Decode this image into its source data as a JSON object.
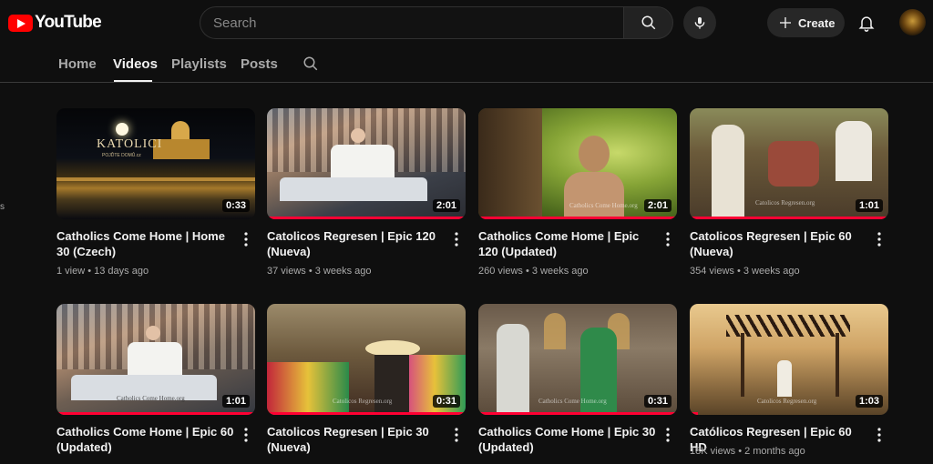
{
  "brand": {
    "name": "YouTube"
  },
  "search": {
    "placeholder": "Search"
  },
  "header": {
    "create_label": "Create"
  },
  "tabs": [
    {
      "label": "Home",
      "active": false
    },
    {
      "label": "Videos",
      "active": true
    },
    {
      "label": "Playlists",
      "active": false
    },
    {
      "label": "Posts",
      "active": false
    }
  ],
  "colors": {
    "brand_red": "#ff0000",
    "progress": "#ff0033",
    "background": "#0f0f0f"
  },
  "icons": [
    "search-icon",
    "mic-icon",
    "plus-icon",
    "bell-icon",
    "more-vert-icon"
  ],
  "videos": [
    {
      "title": "Catholics Come Home | Home 30 (Czech)",
      "meta": "1 view • 13 days ago",
      "duration": "0:33",
      "overlay": "KATOLICI",
      "overlay_sub": "POJĎTE DOMŮ.cz",
      "watched": 0
    },
    {
      "title": "Catolicos Regresen | Epic 120 (Nueva)",
      "meta": "37 views • 3 weeks ago",
      "duration": "2:01",
      "watched": 1.0
    },
    {
      "title": "Catholics Come Home | Epic 120 (Updated)",
      "meta": "260 views • 3 weeks ago",
      "duration": "2:01",
      "watermark": "Catholics Come Home.org",
      "watched": 1.0
    },
    {
      "title": "Catolicos Regresen | Epic 60 (Nueva)",
      "meta": "354 views • 3 weeks ago",
      "duration": "1:01",
      "watermark": "Catolicos Regresen.org",
      "watched": 1.0
    },
    {
      "title": "Catholics Come Home | Epic 60 (Updated)",
      "meta": "",
      "duration": "1:01",
      "watermark": "Catholics Come Home.org",
      "watched": 1.0
    },
    {
      "title": "Catolicos Regresen | Epic 30 (Nueva)",
      "meta": "",
      "duration": "0:31",
      "watermark": "Catolicos Regresen.org",
      "watched": 1.0
    },
    {
      "title": "Catholics Come Home | Epic 30 (Updated)",
      "meta": "",
      "duration": "0:31",
      "watermark": "Catholics Come Home.org",
      "watched": 1.0
    },
    {
      "title": "Católicos Regresen | Epic 60 HD",
      "meta": "18K views • 2 months ago",
      "duration": "1:03",
      "watermark": "Catolicos Regresen.org",
      "watched": 0.04
    }
  ]
}
